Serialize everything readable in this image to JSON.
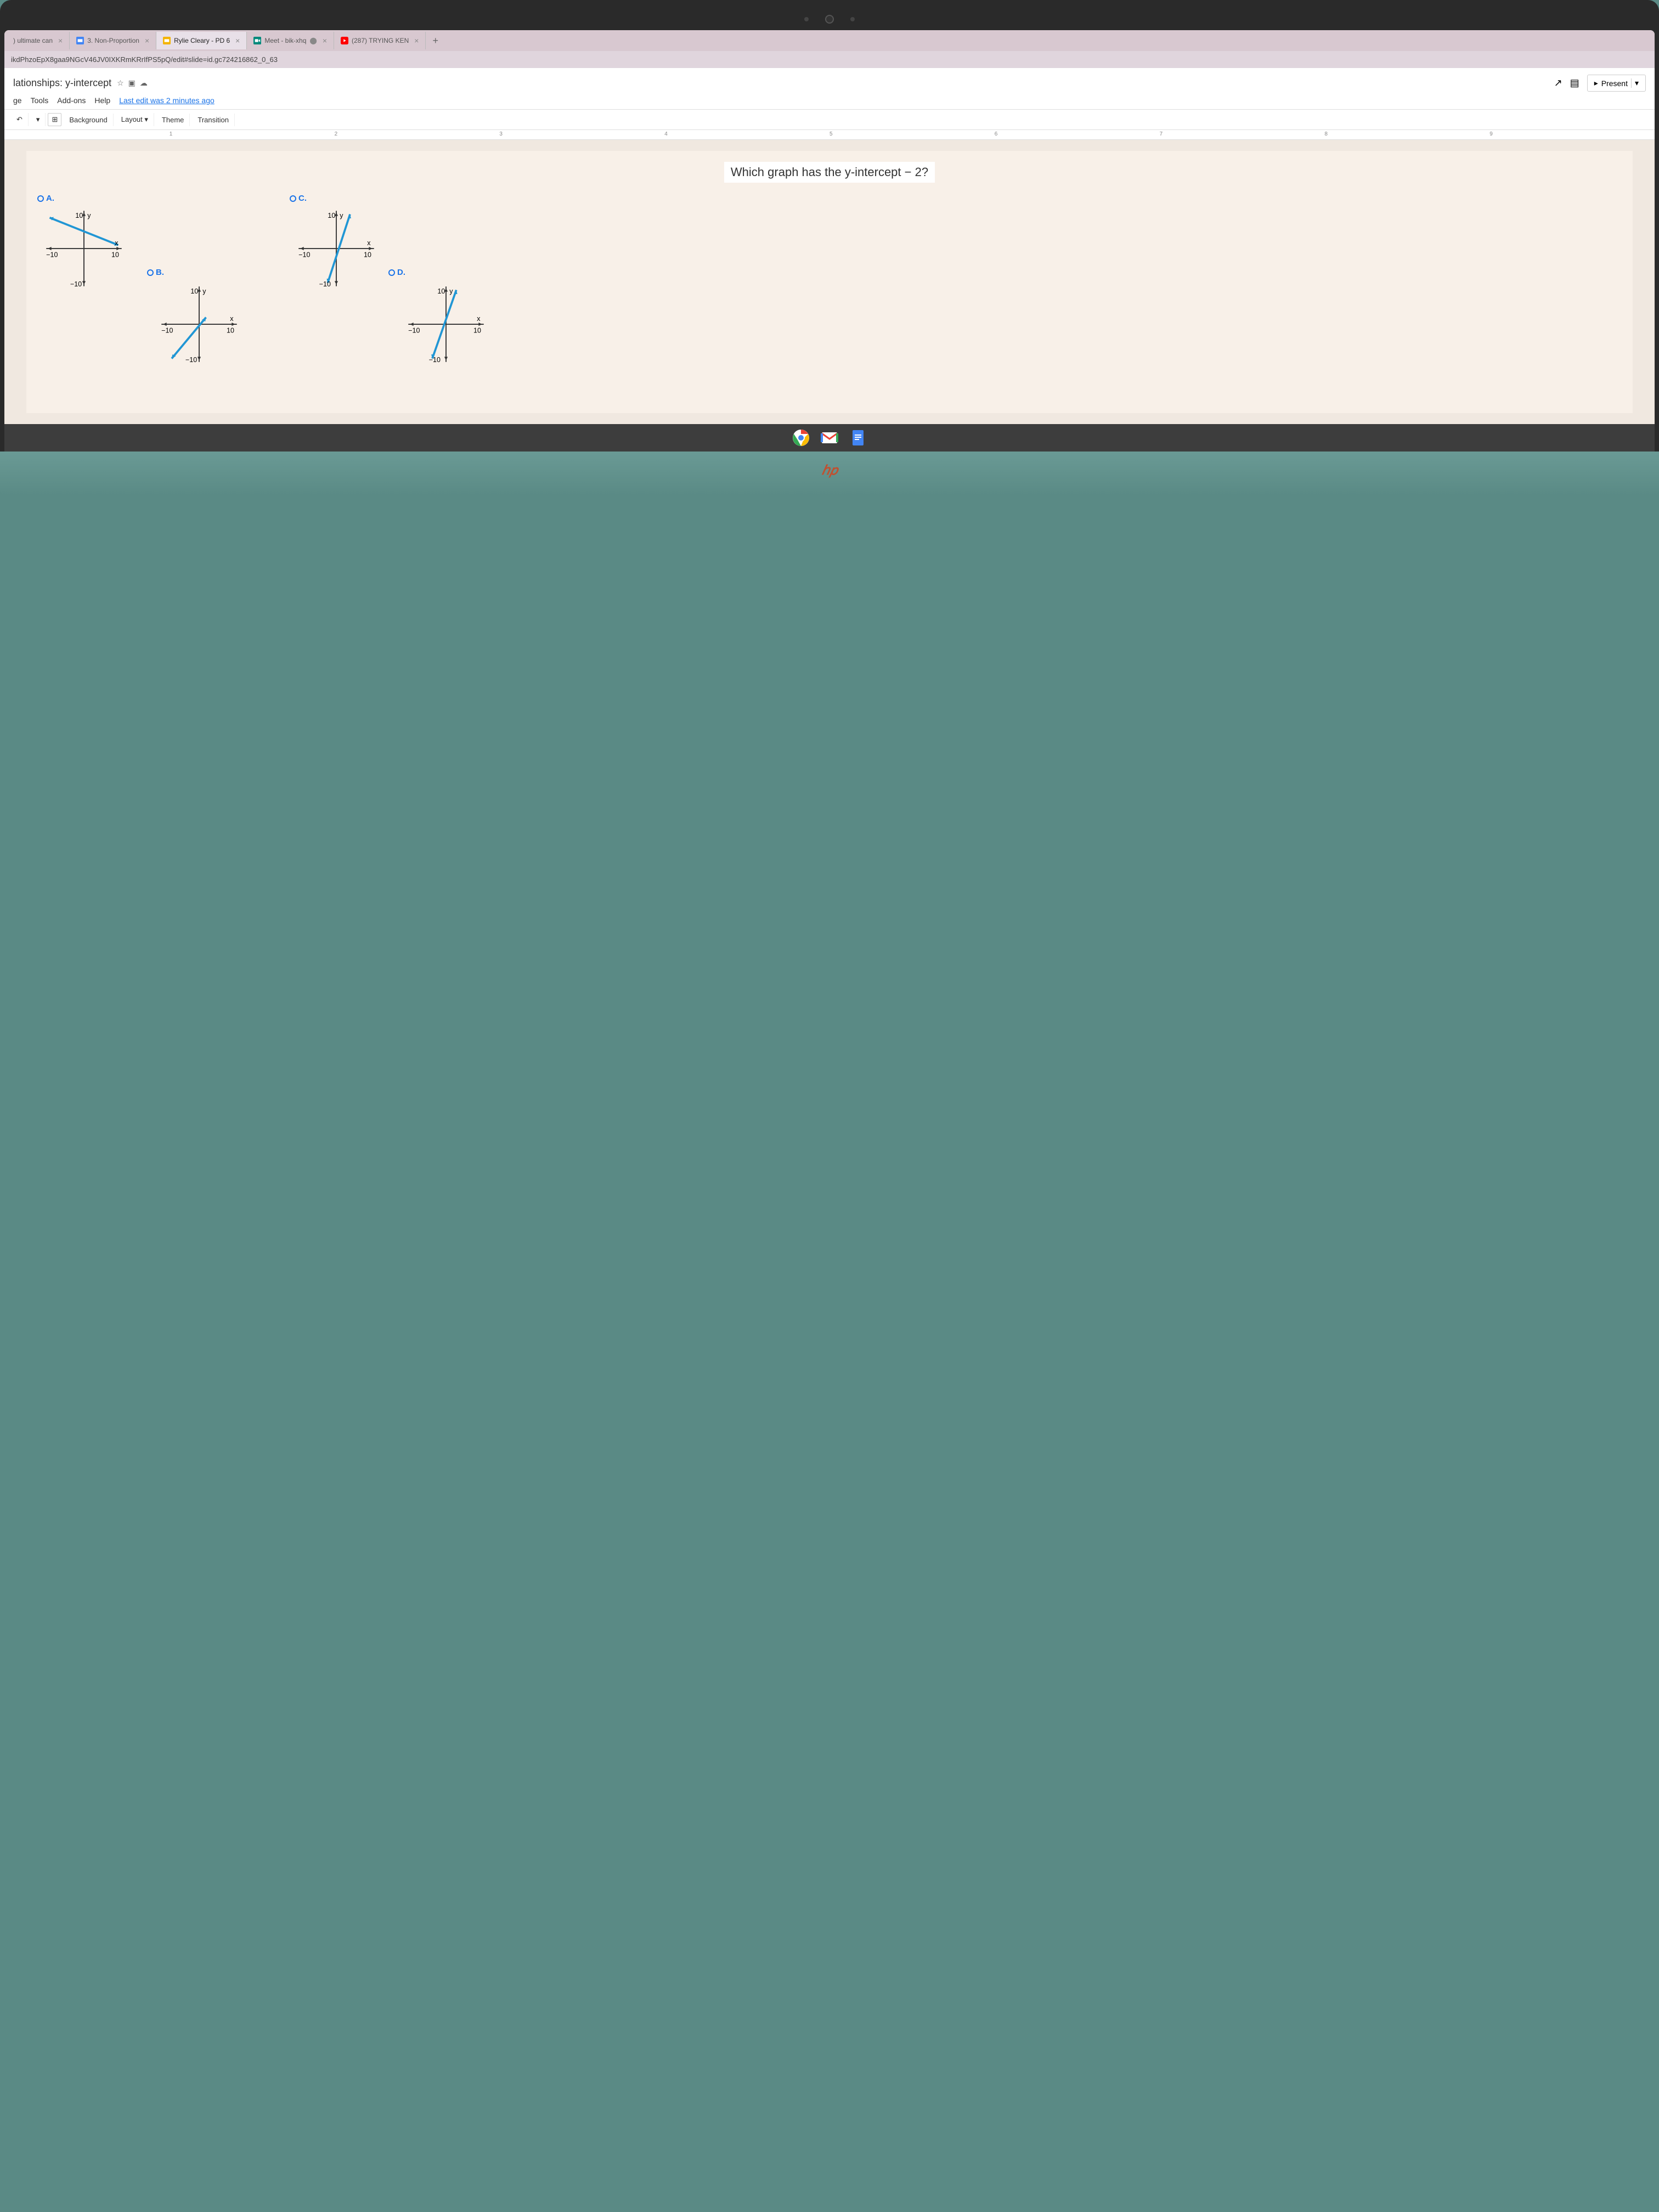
{
  "browser": {
    "tabs": [
      {
        "label": ") ultimate can",
        "icon": "page"
      },
      {
        "label": "3. Non-Proportion",
        "icon": "slides-blue"
      },
      {
        "label": "Rylie Cleary - PD 6",
        "icon": "slides-orange",
        "active": true
      },
      {
        "label": "Meet - bik-xhq",
        "icon": "meet"
      },
      {
        "label": "(287) TRYING KEN",
        "icon": "youtube"
      }
    ],
    "url": "ikdPhzoEpX8gaa9NGcV46JV0IXKRmKRrIfPS5pQ/edit#slide=id.gc724216862_0_63"
  },
  "doc": {
    "title": "lationships: y-intercept",
    "menu": [
      "ge",
      "Tools",
      "Add-ons",
      "Help"
    ],
    "last_edit": "Last edit was 2 minutes ago",
    "present": "Present",
    "toolbar": {
      "background": "Background",
      "layout": "Layout",
      "theme": "Theme",
      "transition": "Transition"
    },
    "ruler_marks": [
      "1",
      "2",
      "3",
      "4",
      "5",
      "6",
      "7",
      "8",
      "9"
    ]
  },
  "slide": {
    "question": "Which graph has the y-intercept − 2?",
    "options": {
      "a": "A.",
      "b": "B.",
      "c": "C.",
      "d": "D."
    },
    "axis_labels": {
      "y_pos": "10",
      "y_neg": "− 10",
      "x_pos": "10",
      "x_neg": "− 10",
      "y": "y",
      "x": "x"
    }
  },
  "chart_data": [
    {
      "id": "A",
      "type": "line",
      "xlabel": "x",
      "ylabel": "y",
      "xlim": [
        -10,
        10
      ],
      "ylim": [
        -10,
        10
      ],
      "y_intercept": 5,
      "slope": -0.4,
      "line_points": [
        [
          -10,
          9
        ],
        [
          10,
          1
        ]
      ]
    },
    {
      "id": "B",
      "type": "line",
      "xlabel": "x",
      "ylabel": "y",
      "xlim": [
        -10,
        10
      ],
      "ylim": [
        -10,
        10
      ],
      "y_intercept": 0,
      "slope": 1.2,
      "line_points": [
        [
          -8,
          -10
        ],
        [
          2,
          2
        ]
      ]
    },
    {
      "id": "C",
      "type": "line",
      "xlabel": "x",
      "ylabel": "y",
      "xlim": [
        -10,
        10
      ],
      "ylim": [
        -10,
        10
      ],
      "y_intercept": -2,
      "slope": 3,
      "line_points": [
        [
          -2.5,
          -10
        ],
        [
          4,
          10
        ]
      ]
    },
    {
      "id": "D",
      "type": "line",
      "xlabel": "x",
      "ylabel": "y",
      "xlim": [
        -10,
        10
      ],
      "ylim": [
        -10,
        10
      ],
      "y_intercept": 2,
      "slope": 3,
      "line_points": [
        [
          -4,
          -10
        ],
        [
          3,
          10
        ]
      ]
    }
  ]
}
